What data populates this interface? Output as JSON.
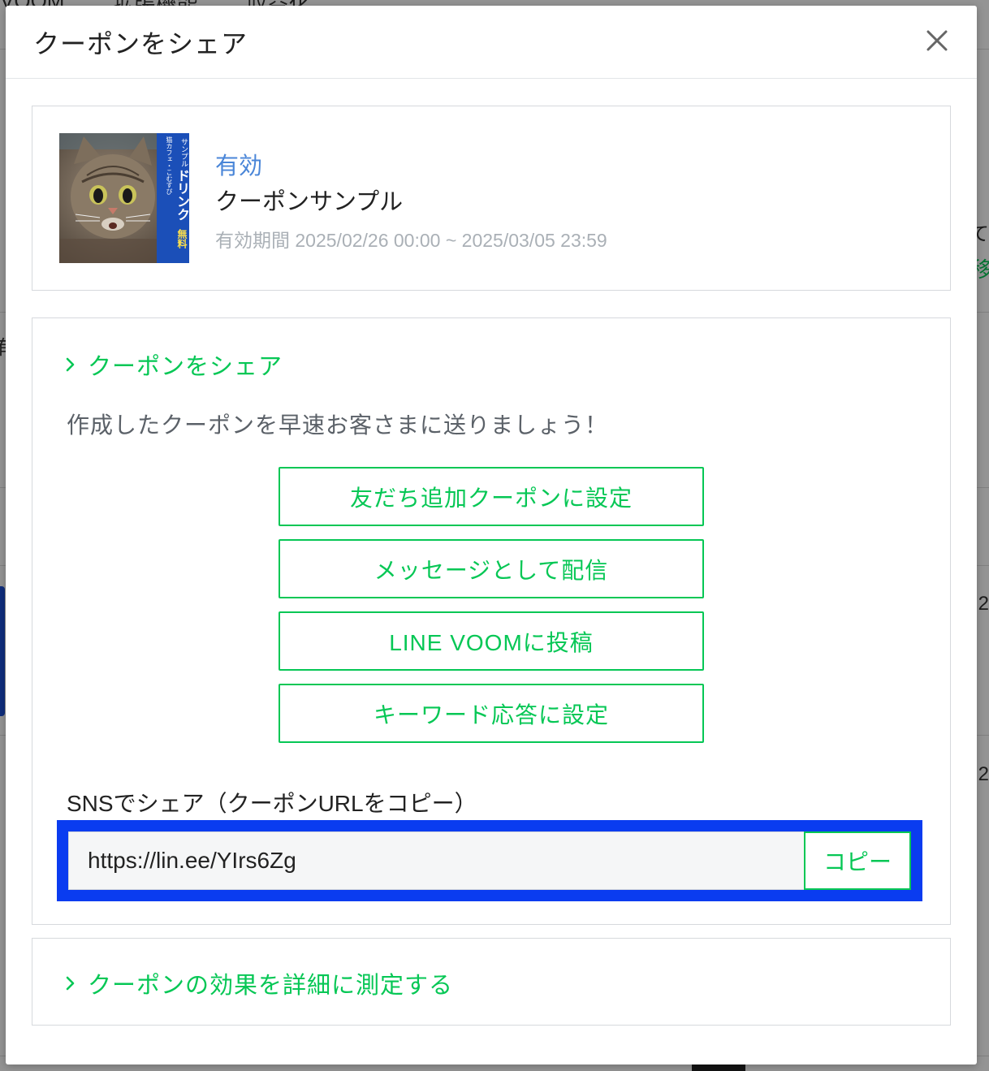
{
  "background": {
    "tabs": [
      "VOOM",
      "拡張機能",
      "収益化"
    ],
    "right_fragments": [
      "て",
      "2",
      "2"
    ],
    "right_green": "移",
    "left_fragment": "有"
  },
  "modal": {
    "title": "クーポンをシェア",
    "close_icon": "close-icon"
  },
  "coupon": {
    "status": "有効",
    "name": "クーポンサンプル",
    "period": "有効期間 2025/02/26 00:00 ~ 2025/03/05 23:59",
    "thumbnail_text": [
      "猫カフェ・こむすび",
      "サンプル",
      "ドリンク",
      "無料"
    ]
  },
  "share_section": {
    "header": "クーポンをシェア",
    "description": "作成したクーポンを早速お客さまに送りましょう！",
    "buttons": [
      {
        "label": "友だち追加クーポンに設定"
      },
      {
        "label": "メッセージとして配信"
      },
      {
        "label": "LINE VOOMに投稿"
      },
      {
        "label": "キーワード応答に設定"
      }
    ],
    "sns_label": "SNSでシェア（クーポンURLをコピー）",
    "url": "https://lin.ee/YIrs6Zg",
    "copy_label": "コピー"
  },
  "measure_section": {
    "header": "クーポンの効果を詳細に測定する"
  },
  "colors": {
    "accent_green": "#06c755",
    "status_blue": "#4a86d8",
    "highlight_blue": "#0a3cf0"
  }
}
